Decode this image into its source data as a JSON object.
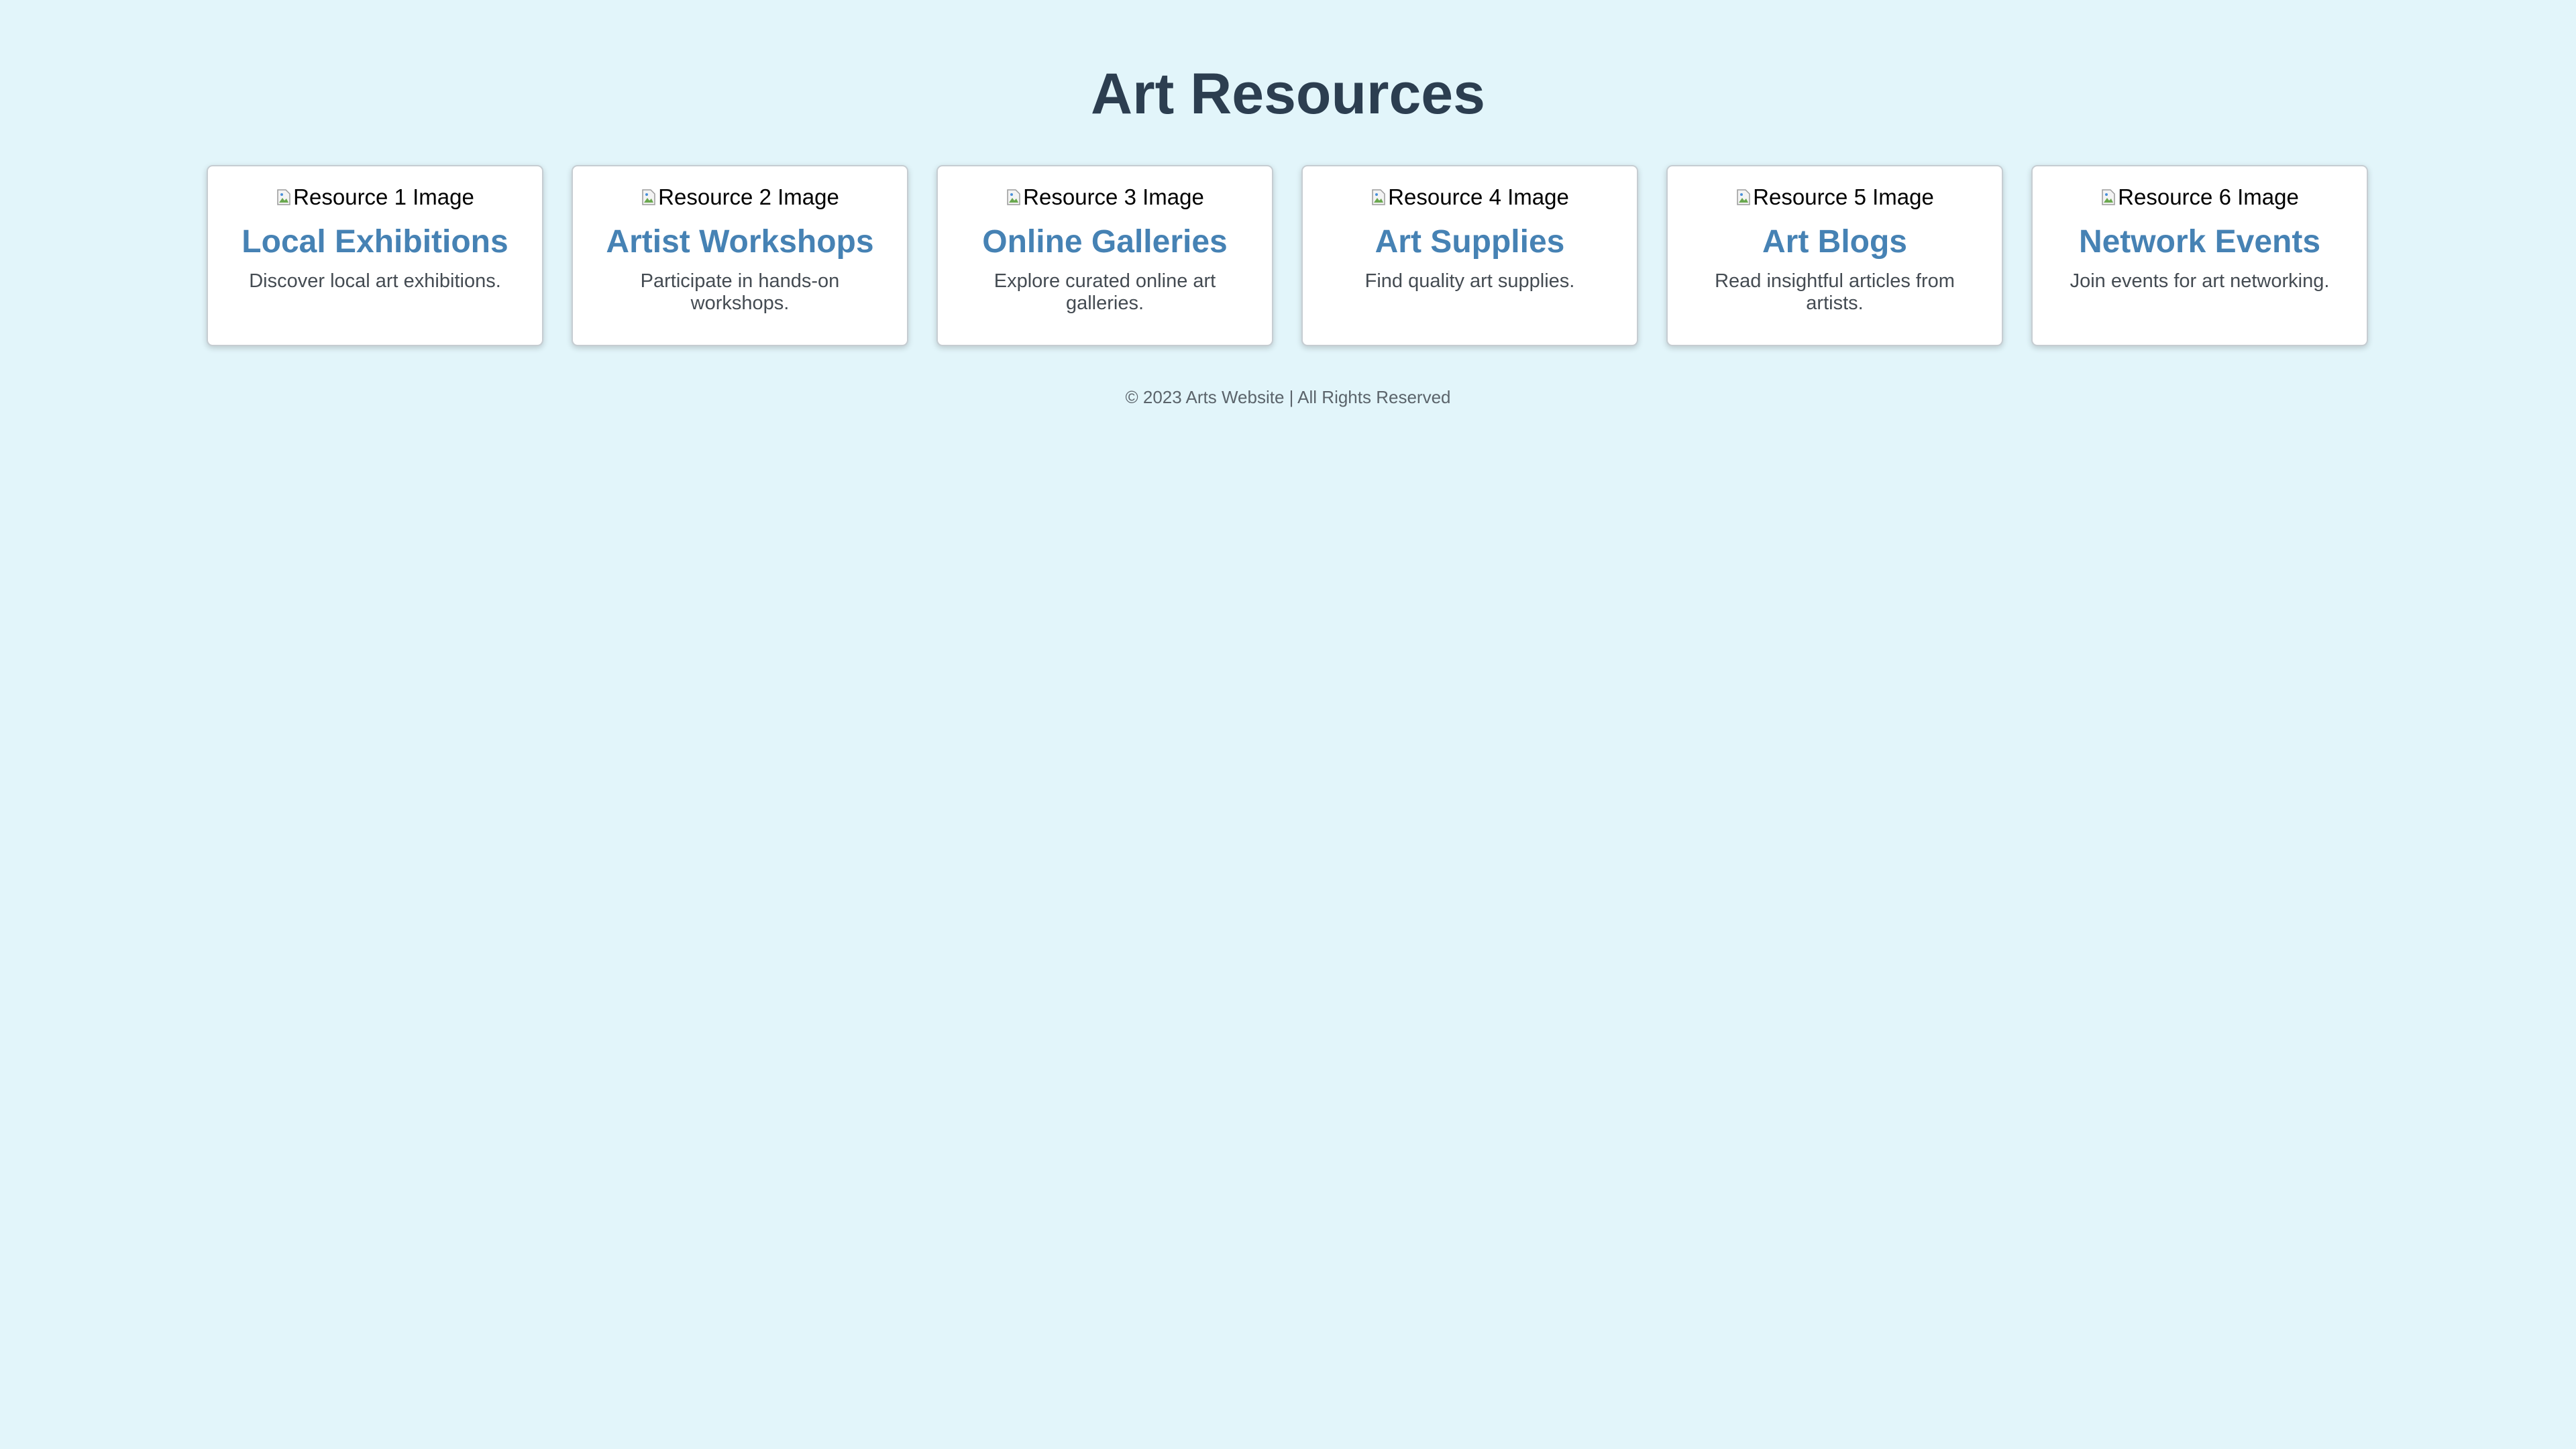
{
  "page": {
    "title": "Art Resources",
    "background_color": "#e2f5fa",
    "title_color": "#2c3e50",
    "accent_color": "#4682b4"
  },
  "resources": [
    {
      "image_alt": "Resource 1 Image",
      "title": "Local Exhibitions",
      "description": "Discover local art exhibitions."
    },
    {
      "image_alt": "Resource 2 Image",
      "title": "Artist Workshops",
      "description": "Participate in hands-on workshops."
    },
    {
      "image_alt": "Resource 3 Image",
      "title": "Online Galleries",
      "description": "Explore curated online art galleries."
    },
    {
      "image_alt": "Resource 4 Image",
      "title": "Art Supplies",
      "description": "Find quality art supplies."
    },
    {
      "image_alt": "Resource 5 Image",
      "title": "Art Blogs",
      "description": "Read insightful articles from artists."
    },
    {
      "image_alt": "Resource 6 Image",
      "title": "Network Events",
      "description": "Join events for art networking."
    }
  ],
  "footer": {
    "text": "© 2023 Arts Website | All Rights Reserved"
  }
}
